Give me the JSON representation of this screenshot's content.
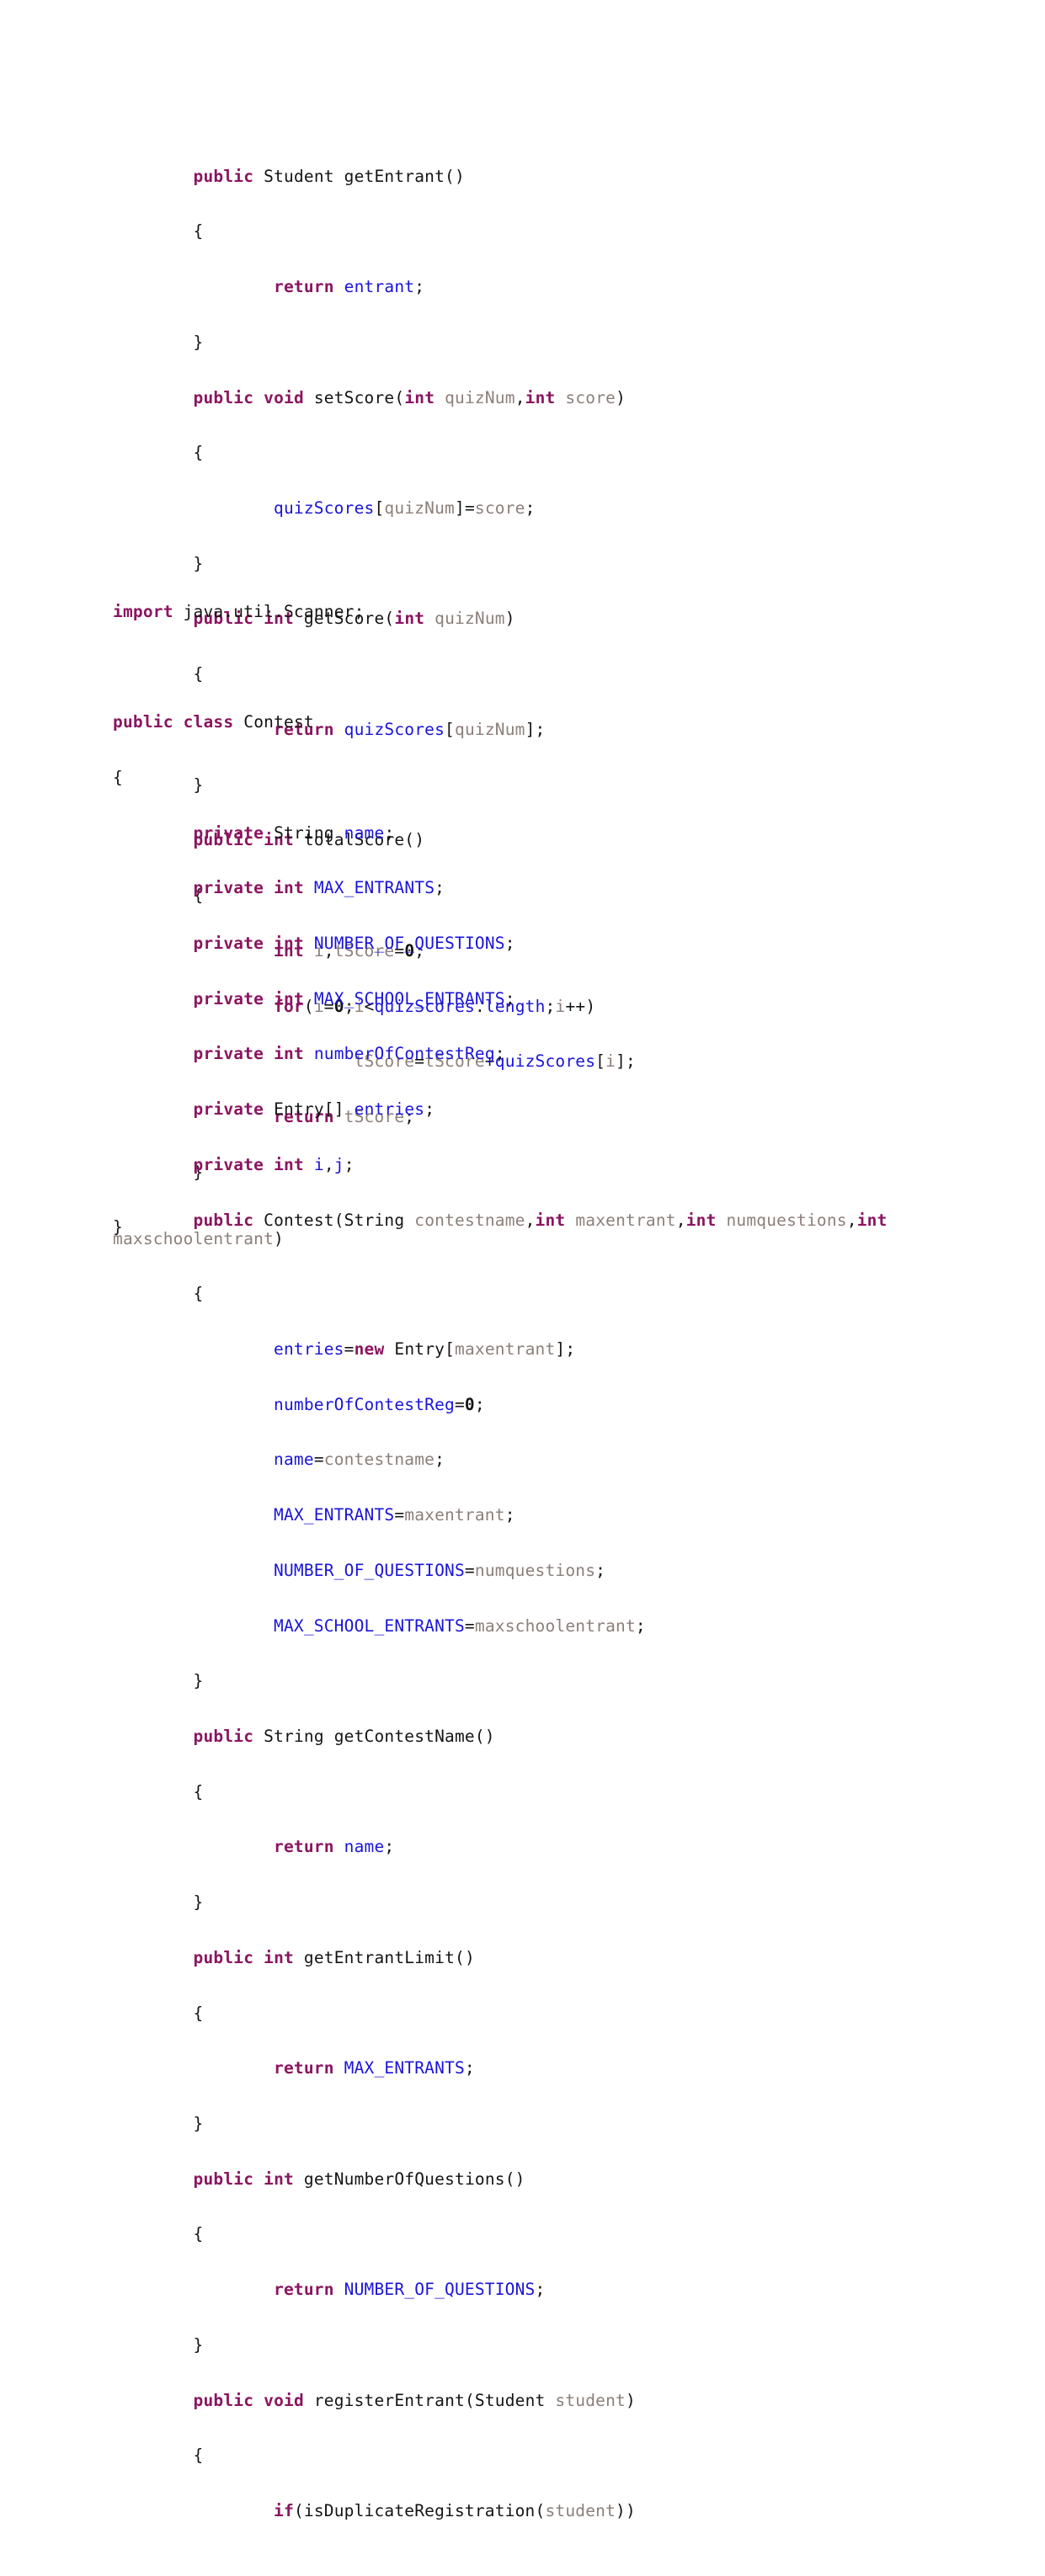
{
  "document": {
    "type": "java-source-listing",
    "page_background": "#ffffff",
    "colors": {
      "keyword": "#8B1560",
      "field_identifier": "#1A14D8",
      "parameter_local": "#8C7F7A",
      "plain": "#141414"
    }
  },
  "blocks": [
    {
      "id": "student-class-tail",
      "name": "student-class-remainder",
      "lines": [
        "        public Student getEntrant()",
        "        {",
        "                return entrant;",
        "        }",
        "        public void setScore(int quizNum,int score)",
        "        {",
        "                quizScores[quizNum]=score;",
        "        }",
        "        public int getScore(int quizNum)",
        "        {",
        "                return quizScores[quizNum];",
        "        }",
        "        public int totalScore()",
        "        {",
        "                int i,tScore=0;",
        "                for(i=0;i<quizScores.length;i++)",
        "                        tScore=tScore+quizScores[i];",
        "                return tScore;",
        "        }",
        "}"
      ]
    },
    {
      "id": "contest-class",
      "name": "contest-class-listing",
      "lines": [
        "import java.util.Scanner;",
        "",
        "public class Contest",
        "{",
        "        private String name;",
        "        private int MAX_ENTRANTS;",
        "        private int NUMBER_OF_QUESTIONS;",
        "        private int MAX_SCHOOL_ENTRANTS;",
        "        private int numberOfContestReg;",
        "        private Entry[] entries;",
        "        private int i,j;",
        "        public Contest(String contestname,int maxentrant,int numquestions,int maxschoolentrant)",
        "        {",
        "                entries=new Entry[maxentrant];",
        "                numberOfContestReg=0;",
        "                name=contestname;",
        "                MAX_ENTRANTS=maxentrant;",
        "                NUMBER_OF_QUESTIONS=numquestions;",
        "                MAX_SCHOOL_ENTRANTS=maxschoolentrant;",
        "        }",
        "        public String getContestName()",
        "        {",
        "                return name;",
        "        }",
        "        public int getEntrantLimit()",
        "        {",
        "                return MAX_ENTRANTS;",
        "        }",
        "        public int getNumberOfQuestions()",
        "        {",
        "                return NUMBER_OF_QUESTIONS;",
        "        }",
        "        public void registerEntrant(Student student)",
        "        {",
        "                if(isDuplicateRegistration(student))"
      ]
    }
  ],
  "tokens": {
    "keywords": [
      "public",
      "private",
      "int",
      "void",
      "class",
      "import",
      "return",
      "new",
      "for",
      "if"
    ],
    "types": [
      "Student",
      "String",
      "Entry",
      "Contest",
      "Scanner"
    ],
    "fields": [
      "entrant",
      "quizScores",
      "length",
      "name",
      "MAX_ENTRANTS",
      "NUMBER_OF_QUESTIONS",
      "MAX_SCHOOL_ENTRANTS",
      "numberOfContestReg",
      "entries",
      "i",
      "j"
    ],
    "methods": [
      "getEntrant",
      "setScore",
      "getScore",
      "totalScore",
      "getContestName",
      "getEntrantLimit",
      "getNumberOfQuestions",
      "registerEntrant",
      "isDuplicateRegistration"
    ],
    "parameters": [
      "quizNum",
      "score",
      "tScore",
      "contestname",
      "maxentrant",
      "numquestions",
      "maxschoolentrant",
      "student"
    ]
  }
}
